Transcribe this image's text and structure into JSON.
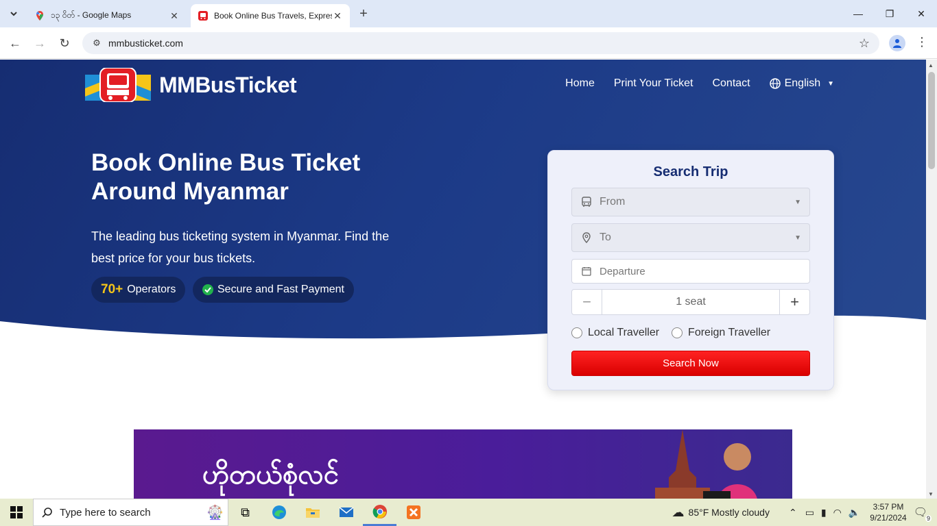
{
  "browser": {
    "tabs": [
      {
        "title": "၁၃ ဝိတ် - Google Maps",
        "active": false
      },
      {
        "title": "Book Online Bus Travels, Expres",
        "active": true
      }
    ],
    "url": "mmbusticket.com"
  },
  "site": {
    "brand": "MMBusTicket",
    "nav": {
      "home": "Home",
      "print": "Print Your Ticket",
      "contact": "Contact",
      "language": "English"
    },
    "headline_1": "Book Online Bus Ticket",
    "headline_2": "Around Myanmar",
    "subtitle": "The leading bus ticketing system in Myanmar. Find the best price for your bus tickets.",
    "badges": {
      "operators_count": "70+",
      "operators_label": "Operators",
      "payment": "Secure and Fast Payment"
    },
    "search": {
      "title": "Search Trip",
      "from_placeholder": "From",
      "to_placeholder": "To",
      "departure_placeholder": "Departure",
      "seats": "1 seat",
      "local": "Local Traveller",
      "foreign": "Foreign Traveller",
      "button": "Search Now"
    },
    "banner_text": "ဟိုတယ်စုံလင်"
  },
  "taskbar": {
    "search_placeholder": "Type here to search",
    "weather": "85°F  Mostly cloudy",
    "time": "3:57 PM",
    "date": "9/21/2024",
    "notifications": "9"
  },
  "colors": {
    "hero": "#1c3a87",
    "accent": "#e00000",
    "gold": "#f5c518"
  }
}
